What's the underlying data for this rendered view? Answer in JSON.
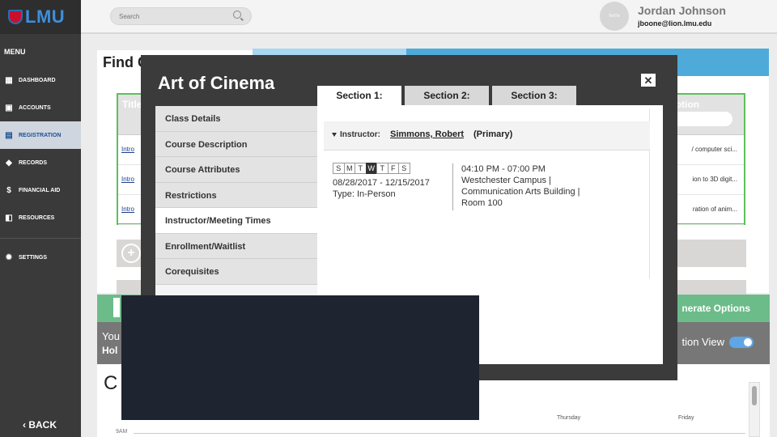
{
  "sidebar": {
    "logo_text": "LMU",
    "menu_title": "MENU",
    "items": [
      {
        "label": "DASHBOARD",
        "icon": "dashboard-icon"
      },
      {
        "label": "ACCOUNTS",
        "icon": "accounts-icon"
      },
      {
        "label": "REGISTRATION",
        "icon": "registration-icon",
        "active": true
      },
      {
        "label": "RECORDS",
        "icon": "records-icon"
      },
      {
        "label": "FINANCIAL AID",
        "icon": "dollar-icon"
      },
      {
        "label": "RESOURCES",
        "icon": "resources-icon"
      },
      {
        "label": "SETTINGS",
        "icon": "gear-icon"
      }
    ],
    "back_label": "BACK",
    "active_color": "#1d4f91"
  },
  "topbar": {
    "search_placeholder": "Search",
    "user_name": "Jordan Johnson",
    "user_email": "jboone@lion.lmu.edu",
    "avatar_text": "TeXTe"
  },
  "background": {
    "find_title": "Find C",
    "results_header": {
      "title": "Title",
      "option": "ption"
    },
    "rows": [
      {
        "link": "Intro",
        "desc": "/ computer sci..."
      },
      {
        "link": "Intro",
        "desc": "ion to 3D digit..."
      },
      {
        "link": "Intro",
        "desc": "ration of anim..."
      }
    ],
    "generate_label": "nerate Options",
    "hold_you": "You",
    "hold_label": "Hol",
    "view_label": "tion View",
    "calendar_letter": "C",
    "day_labels": [
      "Thursday",
      "Friday"
    ],
    "time_label": "9AM"
  },
  "modal": {
    "title": "Art of Cinema",
    "close_icon": "close-icon",
    "tabs": [
      "Section 1:",
      "Section 2:",
      "Section 3:"
    ],
    "active_tab": 0,
    "side_menu": [
      "Class Details",
      "Course Description",
      "Course Attributes",
      "Restrictions",
      "Instructor/Meeting Times",
      "Enrollment/Waitlist",
      "Corequisites"
    ],
    "active_side_item": 4,
    "instructor": {
      "label": "Instructor:",
      "name": "Simmons, Robert",
      "role": "(Primary)"
    },
    "meeting": {
      "days": [
        "S",
        "M",
        "T",
        "W",
        "T",
        "F",
        "S"
      ],
      "active_days": [
        3
      ],
      "dates": "08/28/2017 - 12/15/2017",
      "type": "Type: In-Person",
      "time": "04:10 PM - 07:00 PM",
      "location_line1": "Westchester Campus |",
      "location_line2": "Communication Arts Building |",
      "location_line3": "Room 100"
    }
  }
}
